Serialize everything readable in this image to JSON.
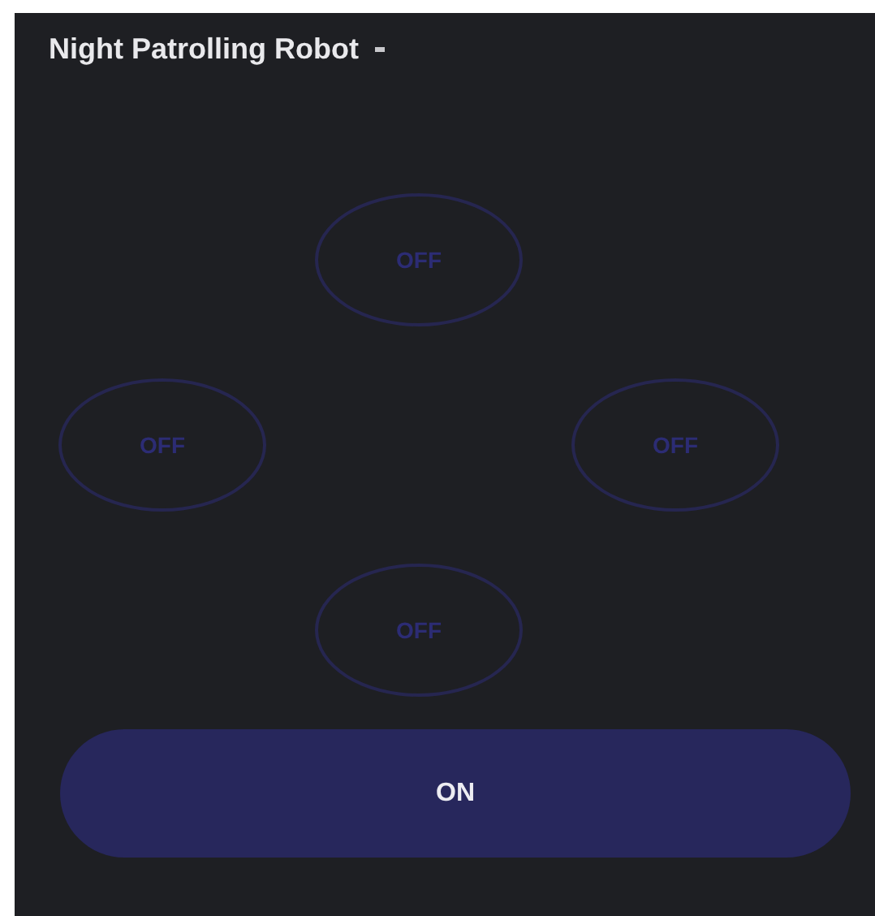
{
  "header": {
    "title": "Night Patrolling Robot"
  },
  "direction_buttons": [
    {
      "kind": "up",
      "label": "OFF",
      "on": false
    },
    {
      "kind": "left",
      "label": "OFF",
      "on": false
    },
    {
      "kind": "right",
      "label": "OFF",
      "on": false
    },
    {
      "kind": "down",
      "label": "OFF",
      "on": false
    }
  ],
  "main_button": {
    "label": "ON"
  }
}
